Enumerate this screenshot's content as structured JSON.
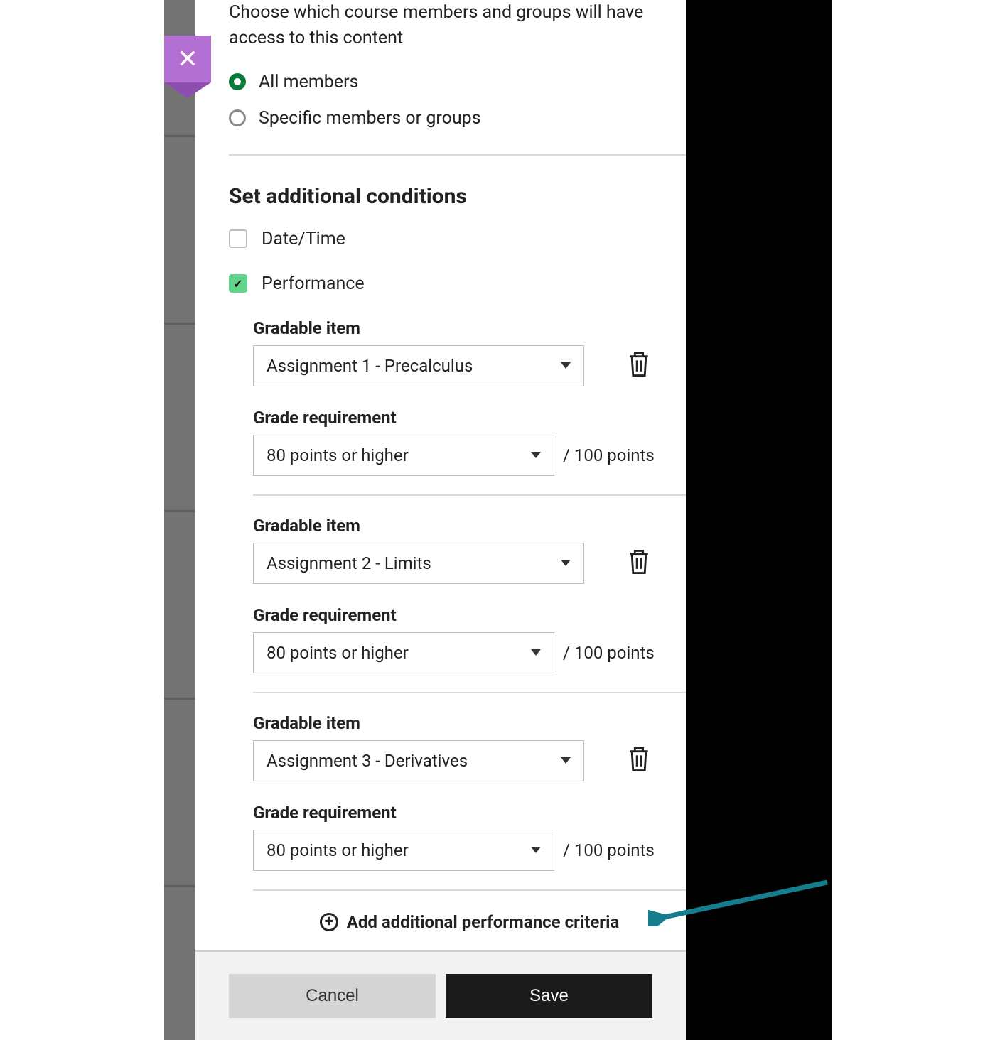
{
  "access": {
    "description": "Choose which course members and groups will have access to this content",
    "options": {
      "all": "All members",
      "specific": "Specific members or groups"
    }
  },
  "conditions": {
    "title": "Set additional conditions",
    "datetime": {
      "label": "Date/Time"
    },
    "performance": {
      "label": "Performance",
      "gradable_item_label": "Gradable item",
      "grade_req_label": "Grade requirement",
      "points_suffix": "/ 100 points",
      "criteria": [
        {
          "item": "Assignment 1 - Precalculus",
          "requirement": "80 points or higher"
        },
        {
          "item": "Assignment 2 - Limits",
          "requirement": "80 points or higher"
        },
        {
          "item": "Assignment 3 - Derivatives",
          "requirement": "80 points or higher"
        }
      ],
      "add_label": "Add additional performance criteria"
    }
  },
  "footer": {
    "cancel": "Cancel",
    "save": "Save"
  },
  "colors": {
    "accent_green": "#0a7a3b",
    "checkbox_green": "#5fd48a",
    "close_purple": "#b36fd1",
    "arrow_teal": "#167d8c"
  }
}
